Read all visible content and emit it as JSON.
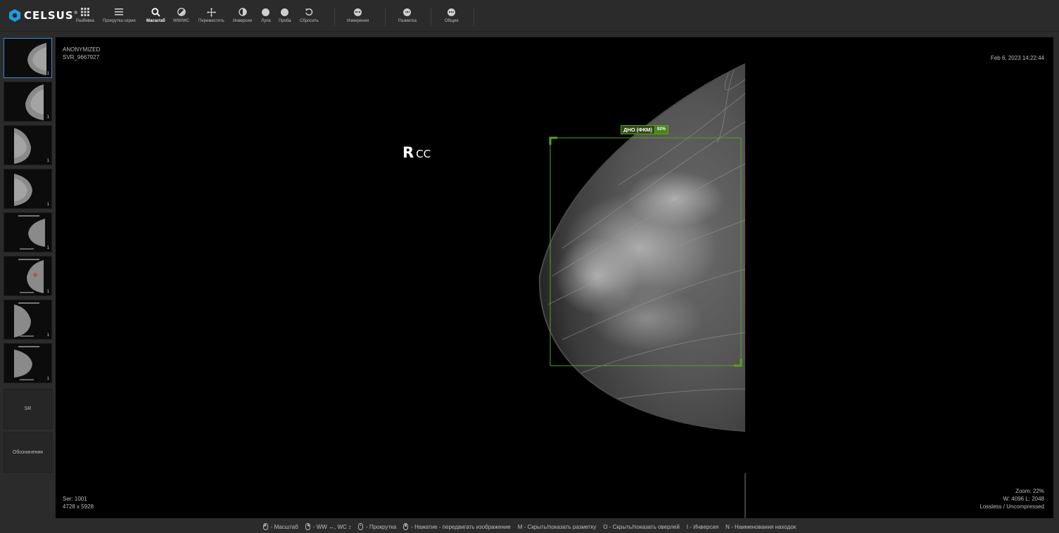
{
  "brand": {
    "name": "CELSUS",
    "mark": "®"
  },
  "toolbar": {
    "tools": [
      {
        "id": "layout",
        "label": "Разбивка",
        "icon": "grid-icon"
      },
      {
        "id": "scroll",
        "label": "Прокрутка серии",
        "icon": "list-icon"
      },
      {
        "id": "zoom",
        "label": "Масштаб",
        "icon": "magnifier-icon",
        "active": true
      },
      {
        "id": "wwwc",
        "label": "WW/WC",
        "icon": "contrast-icon"
      },
      {
        "id": "pan",
        "label": "Переместить",
        "icon": "move-icon"
      },
      {
        "id": "invert",
        "label": "Инверсия",
        "icon": "invert-icon"
      },
      {
        "id": "magnify",
        "label": "Лупа",
        "icon": "circle-icon"
      },
      {
        "id": "probe",
        "label": "Проба",
        "icon": "circle-icon"
      },
      {
        "id": "reset",
        "label": "Сбросить",
        "icon": "reset-icon"
      }
    ],
    "menus": [
      {
        "id": "measurements",
        "label": "Измерения",
        "icon": "more-icon"
      },
      {
        "id": "markup",
        "label": "Разметка",
        "icon": "more-icon"
      },
      {
        "id": "general",
        "label": "Общие",
        "icon": "more-icon"
      }
    ]
  },
  "sidebar": {
    "thumbnails": [
      {
        "count": "1",
        "selected": true
      },
      {
        "count": "1"
      },
      {
        "count": "1"
      },
      {
        "count": "1"
      },
      {
        "count": "1"
      },
      {
        "count": "1"
      },
      {
        "count": "1"
      },
      {
        "count": "1"
      }
    ],
    "sr_label": "SR",
    "legend_label": "Обозначения"
  },
  "viewport": {
    "patient": "ANONYMIZED",
    "study_id": "SVR_9667927",
    "datetime": "Feb 6, 2023 14:22:44",
    "orientation_main": "R",
    "orientation_sub": "CC",
    "series": "Ser: 1001",
    "dimensions": "4728 x 5928",
    "zoom": "Zoom: 22%",
    "window": "W: 4096 L: 2048",
    "compression": "Lossless / Uncompressed",
    "finding": {
      "name": "ДНО (ФКМ)",
      "confidence": "92%",
      "color": "#5aa11f"
    }
  },
  "hints": [
    {
      "icon": "mouse-left-icon",
      "text": "- Масштаб"
    },
    {
      "icon": "mouse-right-icon",
      "text": "- WW ↔, WC ↕"
    },
    {
      "icon": "mouse-wheel-icon",
      "text": "- Прокрутка"
    },
    {
      "icon": "mouse-middle-icon",
      "text": "- Нажатие - передвигать изображение"
    },
    {
      "icon": "",
      "text": "M - Скрыть/показать разметку"
    },
    {
      "icon": "",
      "text": "O - Скрыть/показать оверлей"
    },
    {
      "icon": "",
      "text": "I - Инверсия"
    },
    {
      "icon": "",
      "text": "N - Наименования находок"
    }
  ]
}
